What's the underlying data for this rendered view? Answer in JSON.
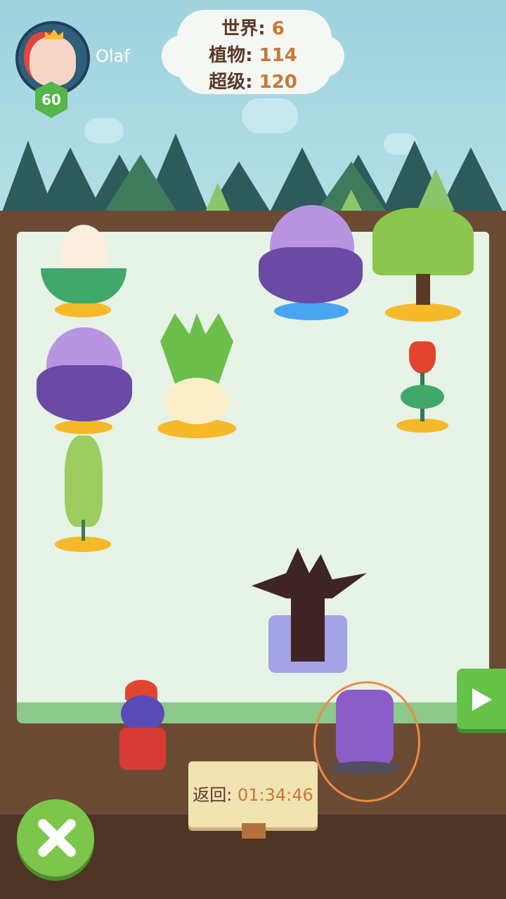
{
  "player": {
    "name": "Olaf",
    "level": "60"
  },
  "stats": {
    "world_label": "世界:",
    "world_value": "6",
    "plants_label": "植物:",
    "plants_value": "114",
    "super_label": "超级:",
    "super_value": "120"
  },
  "timer": {
    "label": "返回:",
    "value": "01:34:46"
  },
  "icons": {
    "next": "play-arrow-icon",
    "close": "close-x-icon"
  },
  "colors": {
    "accent_green": "#67c24a",
    "stat_value": "#c97834",
    "stat_label": "#5a3a26"
  }
}
